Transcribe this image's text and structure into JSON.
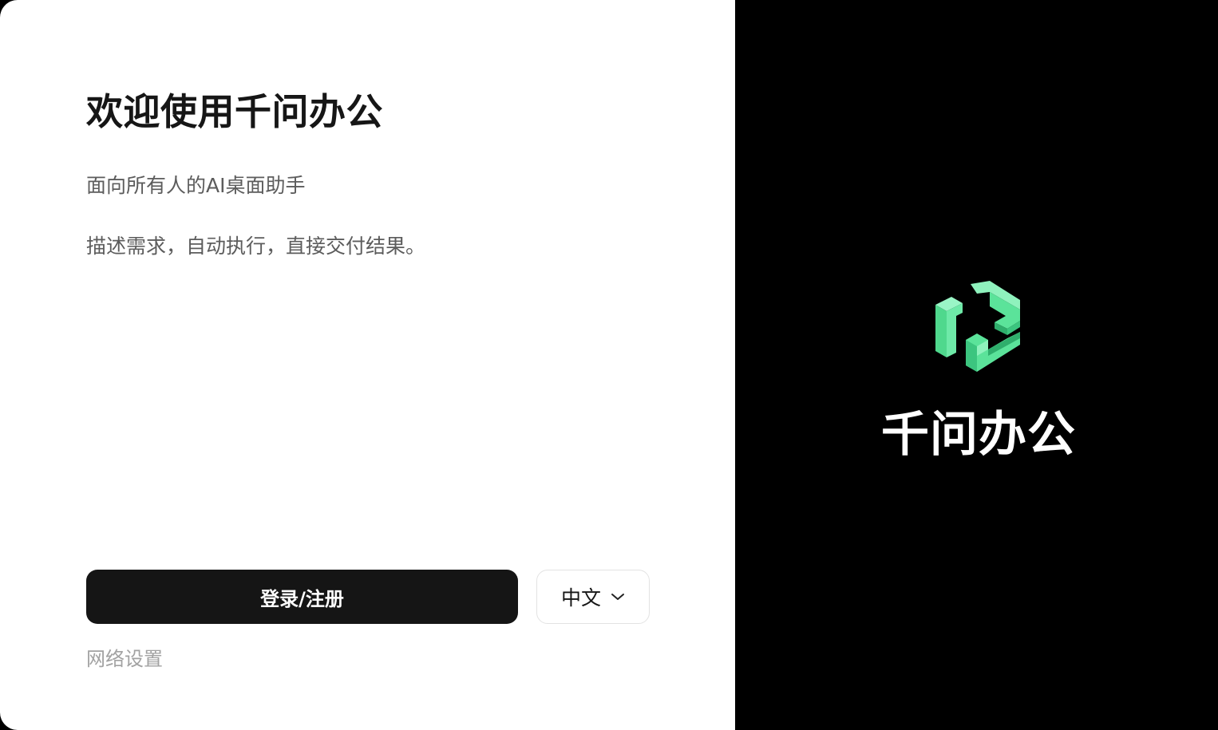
{
  "welcome": {
    "title": "欢迎使用千问办公",
    "subtitle_lines": [
      "面向所有人的AI桌面助手",
      "描述需求，自动执行，直接交付结果。"
    ]
  },
  "actions": {
    "login_label": "登录/注册",
    "language_selected": "中文",
    "network_settings_label": "网络设置"
  },
  "brand": {
    "name": "千问办公",
    "logo_icon": "qianwen-office-logo-icon",
    "logo_color": "#5BE39A"
  },
  "colors": {
    "button_bg": "#151515",
    "panel_dark": "#000000",
    "panel_light": "#ffffff"
  }
}
